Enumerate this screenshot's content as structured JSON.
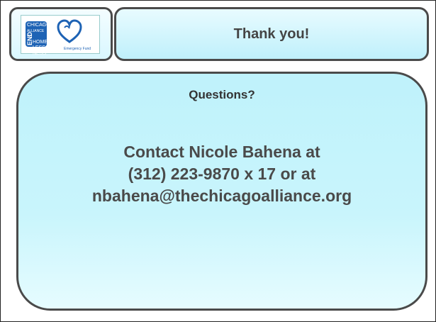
{
  "logo": {
    "org_lines": [
      "CHICAGO",
      "ALLIANCE TO",
      "HOME",
      "LESS",
      "NESS"
    ],
    "end_word": "END",
    "tagline": "Emergency Fund"
  },
  "title": "Thank you!",
  "content": {
    "heading": "Questions?",
    "lines": [
      "Contact Nicole Bahena at",
      "(312) 223-9870 x 17 or at",
      "nbahena@thechicagoalliance.org"
    ]
  },
  "colors": {
    "box_fill": "#bff2fb",
    "border": "#4a4a4a",
    "logo_blue": "#1e63b5",
    "text": "#4a4a4a"
  }
}
